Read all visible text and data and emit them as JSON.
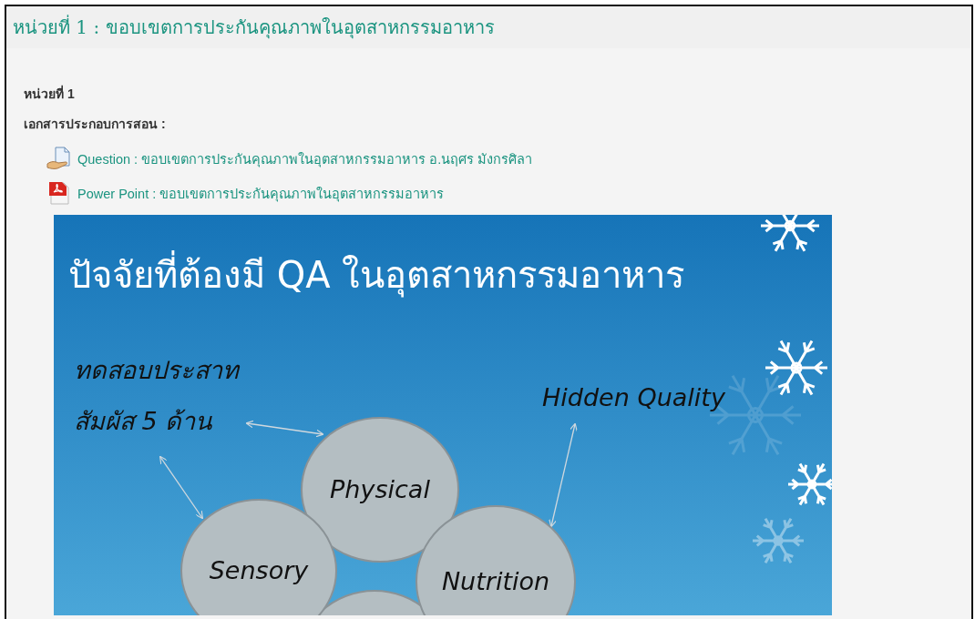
{
  "page_title": "หน่วยที่ 1 : ขอบเขตการประกันคุณภาพในอุตสาหกรรมอาหาร",
  "section": {
    "heading": "หน่วยที่ 1",
    "materials_label": "เอกสารประกอบการสอน :",
    "resources": [
      {
        "kind": "document",
        "label": "Question : ขอบเขตการประกันคุณภาพในอุตสาหกรรมอาหาร อ.นฤศร มังกรศิลา"
      },
      {
        "kind": "pdf",
        "label": "Power Point : ขอบเขตการประกันคุณภาพในอุตสาหกรรมอาหาร"
      }
    ]
  },
  "slide": {
    "title": "ปัจจัยที่ต้องมี QA ในอุตสาหกรรมอาหาร",
    "notes": [
      "ทดสอบประสาท",
      "สัมผัส 5 ด้าน"
    ],
    "callout": "Hidden Quality",
    "circles": [
      {
        "label": "Physical"
      },
      {
        "label": "Sensory"
      },
      {
        "label": "Nutrition"
      }
    ]
  }
}
